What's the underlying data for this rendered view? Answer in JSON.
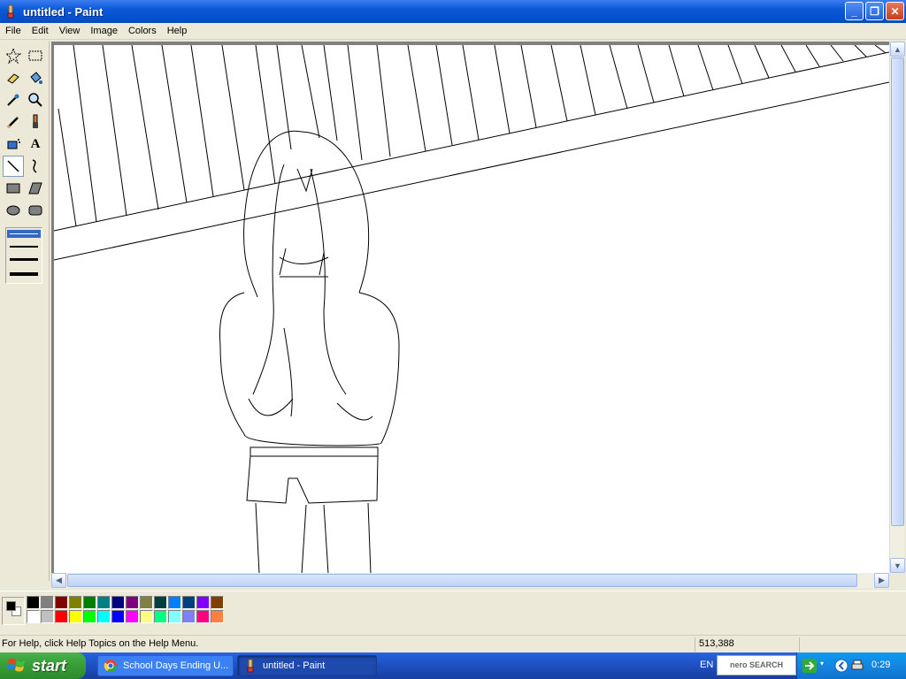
{
  "window": {
    "title": "untitled - Paint",
    "buttons": {
      "minimize": "_",
      "maximize": "❐",
      "close": "✕"
    }
  },
  "menu": [
    "File",
    "Edit",
    "View",
    "Image",
    "Colors",
    "Help"
  ],
  "tools": [
    {
      "name": "free-form-select",
      "icon": "star-select-icon"
    },
    {
      "name": "select",
      "icon": "rect-select-icon"
    },
    {
      "name": "eraser",
      "icon": "eraser-icon"
    },
    {
      "name": "fill",
      "icon": "bucket-icon"
    },
    {
      "name": "pick-color",
      "icon": "eyedropper-icon"
    },
    {
      "name": "magnifier",
      "icon": "magnifier-icon"
    },
    {
      "name": "pencil",
      "icon": "pencil-icon"
    },
    {
      "name": "brush",
      "icon": "brush-icon"
    },
    {
      "name": "airbrush",
      "icon": "airbrush-icon"
    },
    {
      "name": "text",
      "icon": "text-icon",
      "glyph": "A"
    },
    {
      "name": "line",
      "icon": "line-icon",
      "active": true
    },
    {
      "name": "curve",
      "icon": "curve-icon"
    },
    {
      "name": "rectangle",
      "icon": "rectangle-icon"
    },
    {
      "name": "polygon",
      "icon": "polygon-icon"
    },
    {
      "name": "ellipse",
      "icon": "ellipse-icon"
    },
    {
      "name": "rounded-rectangle",
      "icon": "rounded-rect-icon"
    }
  ],
  "line_widths": [
    1,
    2,
    3,
    4
  ],
  "palette": {
    "foreground": "#000000",
    "background": "#ffffff",
    "row1": [
      "#000000",
      "#808080",
      "#800000",
      "#808000",
      "#008000",
      "#008080",
      "#000080",
      "#800080",
      "#808040",
      "#004040",
      "#0080ff",
      "#004080",
      "#8000ff",
      "#804000"
    ],
    "row2": [
      "#ffffff",
      "#c0c0c0",
      "#ff0000",
      "#ffff00",
      "#00ff00",
      "#00ffff",
      "#0000ff",
      "#ff00ff",
      "#ffff80",
      "#00ff80",
      "#80ffff",
      "#8080ff",
      "#ff0080",
      "#ff8040"
    ]
  },
  "status": {
    "help_text": "For Help, click Help Topics on the Help Menu.",
    "coords": "513,388"
  },
  "taskbar": {
    "start_label": "start",
    "tasks": [
      {
        "label": "School Days Ending U...",
        "icon": "chrome-icon"
      },
      {
        "label": "untitled - Paint",
        "icon": "paint-icon",
        "active": true
      }
    ],
    "language": "EN",
    "nero_label": "nero SEARCH",
    "clock": "0:29"
  }
}
